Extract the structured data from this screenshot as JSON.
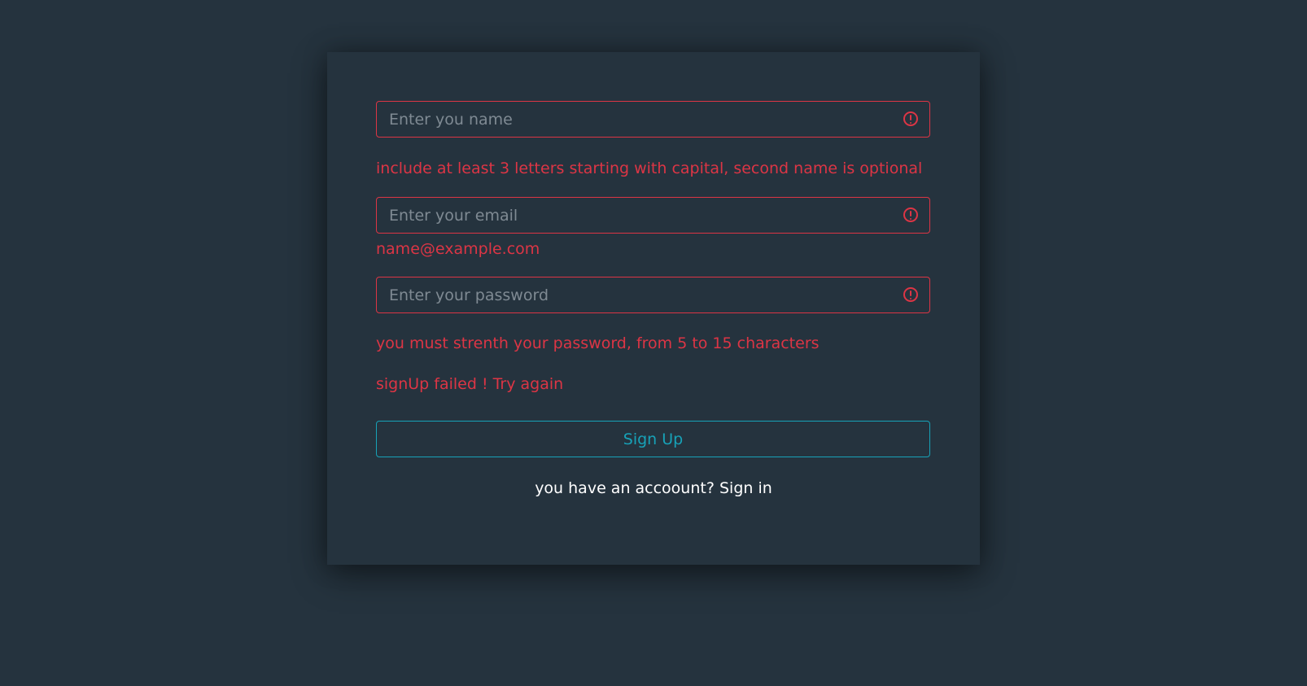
{
  "form": {
    "name": {
      "placeholder": "Enter you name",
      "value": "",
      "error": "include at least 3 letters starting with capital, second name is optional"
    },
    "email": {
      "placeholder": "Enter your email",
      "value": "",
      "error": "name@example.com"
    },
    "password": {
      "placeholder": "Enter your password",
      "value": "",
      "error": "you must strenth your password, from 5 to 15 characters"
    },
    "status_error": "signUp failed ! Try again",
    "submit_label": "Sign Up",
    "footer_text": "you have an accoount?",
    "signin_link": "Sign in"
  },
  "colors": {
    "background": "#25333e",
    "error": "#dc3545",
    "accent": "#17a2b8",
    "text": "#ffffff"
  }
}
